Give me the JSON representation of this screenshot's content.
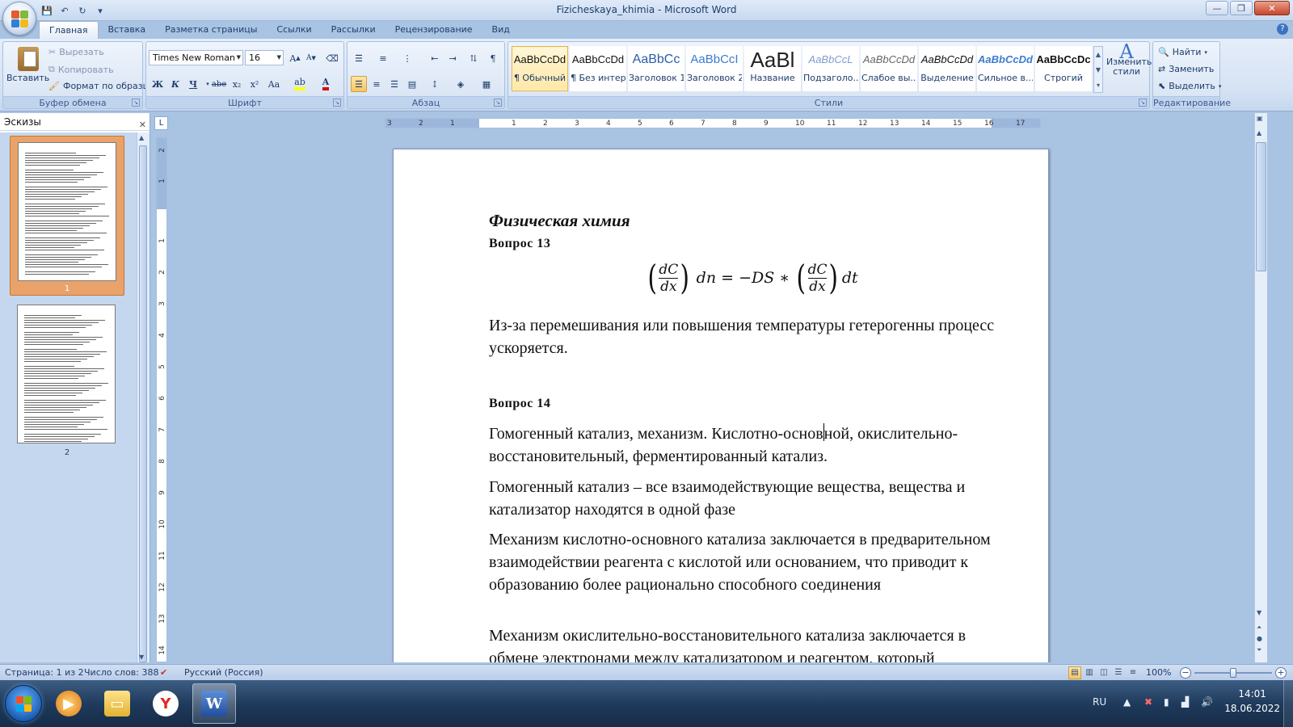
{
  "window": {
    "title": "Fizicheskaya_khimia - Microsoft Word",
    "minimize_icon": "minimize-icon",
    "maximize_icon": "restore-icon",
    "close_icon": "close-icon"
  },
  "quick_access": [
    {
      "name": "save-icon",
      "glyph": "💾"
    },
    {
      "name": "undo-icon",
      "glyph": "↶"
    },
    {
      "name": "redo-icon",
      "glyph": "↻"
    },
    {
      "name": "customize-icon",
      "glyph": "▾"
    }
  ],
  "tabs": [
    {
      "label": "Главная",
      "active": true
    },
    {
      "label": "Вставка"
    },
    {
      "label": "Разметка страницы"
    },
    {
      "label": "Ссылки"
    },
    {
      "label": "Рассылки"
    },
    {
      "label": "Рецензирование"
    },
    {
      "label": "Вид"
    }
  ],
  "ribbon": {
    "clipboard": {
      "label": "Буфер обмена",
      "paste": "Вставить",
      "cut": "Вырезать",
      "copy": "Копировать",
      "format_painter": "Формат по образцу"
    },
    "font": {
      "label": "Шрифт",
      "font_name": "Times New Roman",
      "font_size": "16",
      "bold": "Ж",
      "italic": "К",
      "underline": "Ч",
      "strike": "abe",
      "subscript": "x₂",
      "superscript": "x²",
      "change_case": "Aa",
      "grow": "A",
      "shrink": "A"
    },
    "paragraph": {
      "label": "Абзац",
      "show_marks": "¶"
    },
    "styles": {
      "label": "Стили",
      "items": [
        {
          "sample": "AaBbCcDd",
          "name": "¶ Обычный",
          "selected": true
        },
        {
          "sample": "AaBbCcDd",
          "name": "¶ Без интер..."
        },
        {
          "sample": "AaBbCc",
          "name": "Заголовок 1"
        },
        {
          "sample": "AaBbCcI",
          "name": "Заголовок 2"
        },
        {
          "sample": "AaBl",
          "name": "Название"
        },
        {
          "sample": "AaBbCcL",
          "name": "Подзаголо..."
        },
        {
          "sample": "AaBbCcDd",
          "name": "Слабое вы..."
        },
        {
          "sample": "AaBbCcDd",
          "name": "Выделение"
        },
        {
          "sample": "AaBbCcDd",
          "name": "Сильное в..."
        },
        {
          "sample": "AaBbCcDc",
          "name": "Строгий"
        }
      ],
      "change_styles": "Изменить стили"
    },
    "editing": {
      "label": "Редактирование",
      "find": "Найти",
      "replace": "Заменить",
      "select": "Выделить"
    }
  },
  "thumbnails": {
    "title": "Эскизы",
    "pages": [
      "1",
      "2"
    ]
  },
  "ruler": {
    "h_ticks": [
      "3",
      "2",
      "1",
      "1",
      "2",
      "3",
      "4",
      "5",
      "6",
      "7",
      "8",
      "9",
      "10",
      "11",
      "12",
      "13",
      "14",
      "15",
      "16",
      "17"
    ],
    "v_ticks": [
      "2",
      "1",
      "1",
      "2",
      "3",
      "4",
      "5",
      "6",
      "7",
      "8",
      "9",
      "10",
      "11",
      "12",
      "13",
      "14"
    ],
    "corner": "L"
  },
  "document": {
    "title": "Физическая химия",
    "q13": "Вопрос  13",
    "formula": {
      "num": "dC",
      "den": "dx",
      "mid": "dn = −DS ∗",
      "end": "dt"
    },
    "p1": "Из-за перемешивания или повышения температуры гетерогенны процесс ускоряется.",
    "q14": "Вопрос 14",
    "p2a": "Гомогенный катализ, механизм. Кислотно-основ",
    "p2b": "ной, окислительно-восстановительный, ферментированный катализ.",
    "p3": "Гомогенный катализ – все взаимодействующие вещества, вещества и катализатор находятся в одной фазе",
    "p4": "Механизм кислотно-основного катализа заключается в предварительном взаимодействии реагента с кислотой или основанием, что приводит к образованию более рационально способного соединения",
    "p5": "Механизм окислительно-восстановительного катализа заключается в обмене электронами между катализатором и реагентом, который"
  },
  "statusbar": {
    "page": "Страница: 1 из 2",
    "words": "Число слов: 388",
    "language": "Русский (Россия)",
    "zoom": "100%",
    "zoom_value": 100
  },
  "taskbar": {
    "apps": [
      "media-player-icon",
      "file-explorer-icon",
      "yandex-browser-icon",
      "word-icon"
    ],
    "lang": "RU",
    "time": "14:01",
    "date": "18.06.2022"
  }
}
